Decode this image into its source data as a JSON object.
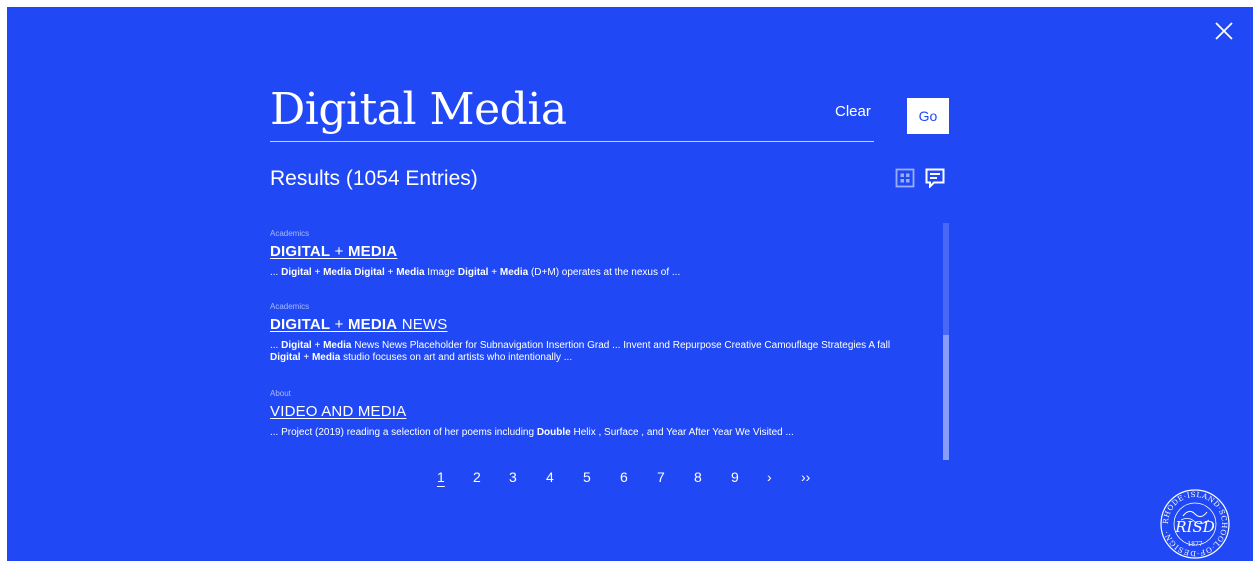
{
  "search": {
    "query": "Digital Media",
    "clear_label": "Clear",
    "go_label": "Go"
  },
  "results_heading": "Results (1054 Entries)",
  "results": [
    {
      "category": "Academics",
      "title_parts": [
        {
          "text": "DIGITAL",
          "bold": true
        },
        {
          "text": " + ",
          "bold": false
        },
        {
          "text": "MEDIA",
          "bold": true
        }
      ],
      "snippet_parts": [
        {
          "text": "... ",
          "bold": false
        },
        {
          "text": "Digital",
          "bold": true
        },
        {
          "text": " + ",
          "bold": false
        },
        {
          "text": "Media Digital",
          "bold": true
        },
        {
          "text": " + ",
          "bold": false
        },
        {
          "text": "Media",
          "bold": true
        },
        {
          "text": " Image ",
          "bold": false
        },
        {
          "text": "Digital",
          "bold": true
        },
        {
          "text": " + ",
          "bold": false
        },
        {
          "text": "Media",
          "bold": true
        },
        {
          "text": " (D+M) operates at the nexus of ...",
          "bold": false
        }
      ]
    },
    {
      "category": "Academics",
      "title_parts": [
        {
          "text": "DIGITAL",
          "bold": true
        },
        {
          "text": " + ",
          "bold": false
        },
        {
          "text": "MEDIA",
          "bold": true
        },
        {
          "text": " NEWS",
          "bold": false
        }
      ],
      "snippet_parts": [
        {
          "text": "... ",
          "bold": false
        },
        {
          "text": "Digital",
          "bold": true
        },
        {
          "text": " + ",
          "bold": false
        },
        {
          "text": "Media",
          "bold": true
        },
        {
          "text": " News News Placeholder for Subnavigation Insertion Grad ... Invent and Repurpose Creative Camouflage Strategies A fall ",
          "bold": false
        },
        {
          "text": "Digital",
          "bold": true
        },
        {
          "text": " + ",
          "bold": false
        },
        {
          "text": "Media",
          "bold": true
        },
        {
          "text": " studio focuses on art and artists who intentionally ...",
          "bold": false
        }
      ]
    },
    {
      "category": "About",
      "title_parts": [
        {
          "text": "VIDEO AND MEDIA",
          "bold": false
        }
      ],
      "snippet_parts": [
        {
          "text": "... Project (2019) reading a selection of her poems including  ",
          "bold": false
        },
        {
          "text": "Double",
          "bold": true
        },
        {
          "text": " Helix , Surface , and  Year After Year We Visited ...",
          "bold": false
        }
      ]
    }
  ],
  "pagination": {
    "pages": [
      "1",
      "2",
      "3",
      "4",
      "5",
      "6",
      "7",
      "8",
      "9"
    ],
    "current": "1",
    "next": "›",
    "last": "››"
  },
  "seal": {
    "arc_text": "RHODE·ISLAND·SCHOOL·OF·DESIGN·",
    "center_text": "RISD",
    "year": "1877"
  },
  "icons": {
    "close": "close-icon",
    "grid_view": "grid-view-icon",
    "list_view": "list-view-icon"
  },
  "colors": {
    "background": "#2049f5",
    "text": "#ffffff",
    "go_button_text": "#2049f5"
  }
}
